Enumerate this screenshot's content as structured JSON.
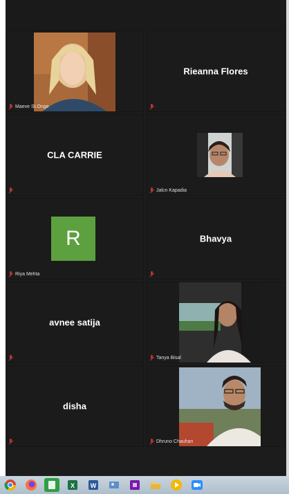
{
  "participants": [
    {
      "name": "Maeve St.Onge",
      "mode": "video"
    },
    {
      "name": "Rieanna Flores",
      "mode": "name"
    },
    {
      "name": "CLA CARRIE",
      "mode": "name"
    },
    {
      "name": "Jalcn Kapadia",
      "mode": "video"
    },
    {
      "name": "Riya Mehta",
      "mode": "avatar",
      "avatar_letter": "R"
    },
    {
      "name": "Bhavya",
      "mode": "name"
    },
    {
      "name": "avnee satija",
      "mode": "name"
    },
    {
      "name": "Tanya Bisal",
      "mode": "video"
    },
    {
      "name": "disha",
      "mode": "name"
    },
    {
      "name": "Dhruno Chauhan",
      "mode": "video"
    }
  ],
  "taskbar": {
    "icons": [
      "chrome-icon",
      "firefox-icon",
      "calculator-icon",
      "excel-icon",
      "word-icon",
      "photos-icon",
      "onenote-icon",
      "file-explorer-icon",
      "media-player-icon",
      "zoom-icon"
    ]
  },
  "colors": {
    "background": "#1c1c1c",
    "avatar_green": "#5da03f",
    "muted_mic": "#d83a3a"
  }
}
